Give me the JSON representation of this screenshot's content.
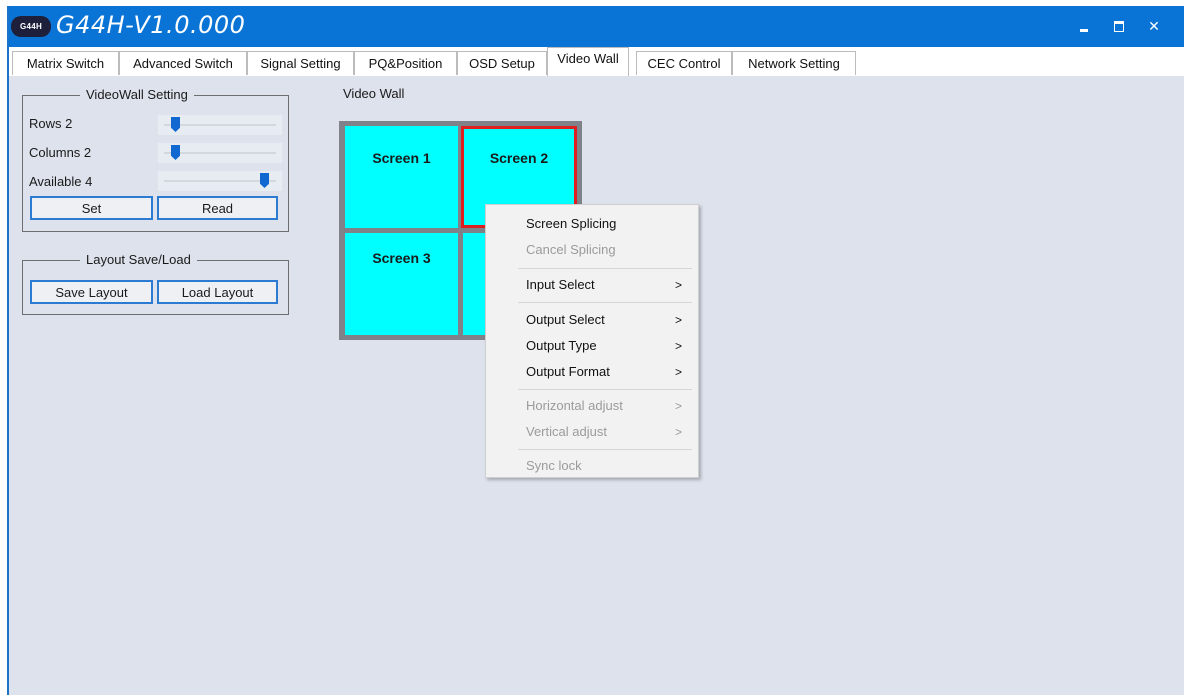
{
  "app": {
    "logo_text": "G44H",
    "title": "G44H-V1.0.000",
    "controls": {
      "minimize_icon": "minimize-icon",
      "maximize_icon": "maximize-icon",
      "close_label": "✕"
    }
  },
  "tabs": [
    {
      "label": "Matrix Switch",
      "active": false
    },
    {
      "label": "Advanced Switch",
      "active": false
    },
    {
      "label": "Signal Setting",
      "active": false
    },
    {
      "label": "PQ&Position",
      "active": false
    },
    {
      "label": "OSD Setup",
      "active": false
    },
    {
      "label": "Video Wall",
      "active": true
    },
    {
      "label": "CEC Control",
      "active": false
    },
    {
      "label": "Network Setting",
      "active": false
    }
  ],
  "videowall_setting": {
    "title": "VideoWall Setting",
    "rows_label": "Rows 2",
    "rows_value": 2,
    "columns_label": "Columns 2",
    "columns_value": 2,
    "available_label": "Available 4",
    "available_value": 4,
    "set_label": "Set",
    "read_label": "Read"
  },
  "layout_save_load": {
    "title": "Layout Save/Load",
    "save_label": "Save Layout",
    "load_label": "Load Layout"
  },
  "video_wall": {
    "label": "Video Wall",
    "screens": [
      {
        "label": "Screen 1",
        "selected": false
      },
      {
        "label": "Screen 2",
        "selected": true
      },
      {
        "label": "Screen 3",
        "selected": false
      },
      {
        "label": "",
        "selected": false
      }
    ],
    "screen_color": "#00ffff",
    "selection_color": "#dd1f1f"
  },
  "context_menu": {
    "items": [
      {
        "label": "Screen Splicing",
        "enabled": true,
        "submenu": false
      },
      {
        "label": "Cancel Splicing",
        "enabled": false,
        "submenu": false
      },
      {
        "label": "Input Select",
        "enabled": true,
        "submenu": true
      },
      {
        "label": "Output Select",
        "enabled": true,
        "submenu": true
      },
      {
        "label": "Output Type",
        "enabled": true,
        "submenu": true
      },
      {
        "label": "Output Format",
        "enabled": true,
        "submenu": true
      },
      {
        "label": "Horizontal adjust",
        "enabled": false,
        "submenu": true
      },
      {
        "label": "Vertical adjust",
        "enabled": false,
        "submenu": true
      },
      {
        "label": "Sync lock",
        "enabled": false,
        "submenu": false
      }
    ],
    "arrow": ">"
  },
  "colors": {
    "title_bar": "#0a74d6",
    "window_bg": "#dde2ec",
    "button_border": "#2b7bd2"
  }
}
